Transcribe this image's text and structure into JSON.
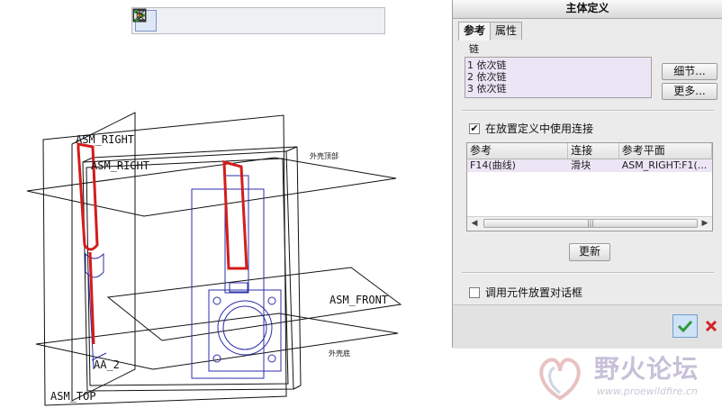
{
  "toolbar": {
    "icons": [
      "zoom-fit-icon",
      "zoom-in-icon",
      "zoom-out-icon",
      "repaint-icon",
      "display-style-icon",
      "saved-views-icon",
      "view-manager-icon",
      "datum-display-icon",
      "spin-center-icon",
      "annotation-icon"
    ]
  },
  "canvas": {
    "labels": {
      "asm_right_1": "ASM_RIGHT",
      "asm_right_2": "ASM_RIGHT",
      "asm_front": "ASM_FRONT",
      "asm_top": "ASM_TOP",
      "aa": "AA_2",
      "small_1": "外壳顶部",
      "small_2": "外壳底"
    }
  },
  "dialog": {
    "title": "主体定义",
    "tabs": [
      "参考",
      "属性"
    ],
    "sublabel": "链",
    "chains": [
      "1 依次链",
      "2 依次链",
      "3 依次链"
    ],
    "detail_button": "细节...",
    "more_button": "更多...",
    "use_connection_label": "在放置定义中使用连接",
    "use_connection_checked": true,
    "table": {
      "headers": [
        "参考",
        "连接",
        "参考平面"
      ],
      "rows": [
        [
          "F14(曲线)",
          "滑块",
          "ASM_RIGHT:F1(..."
        ]
      ]
    },
    "update_button": "更新",
    "component_placement_label": "调用元件放置对话框",
    "component_placement_checked": false
  },
  "watermark": {
    "name": "野火论坛",
    "url": "www.proewildfire.cn"
  },
  "colors": {
    "accent_ok": "#2e9a3a",
    "cancel": "#d42222",
    "highlight_curve": "#d41c1c",
    "list_bg": "#ece5f5"
  }
}
